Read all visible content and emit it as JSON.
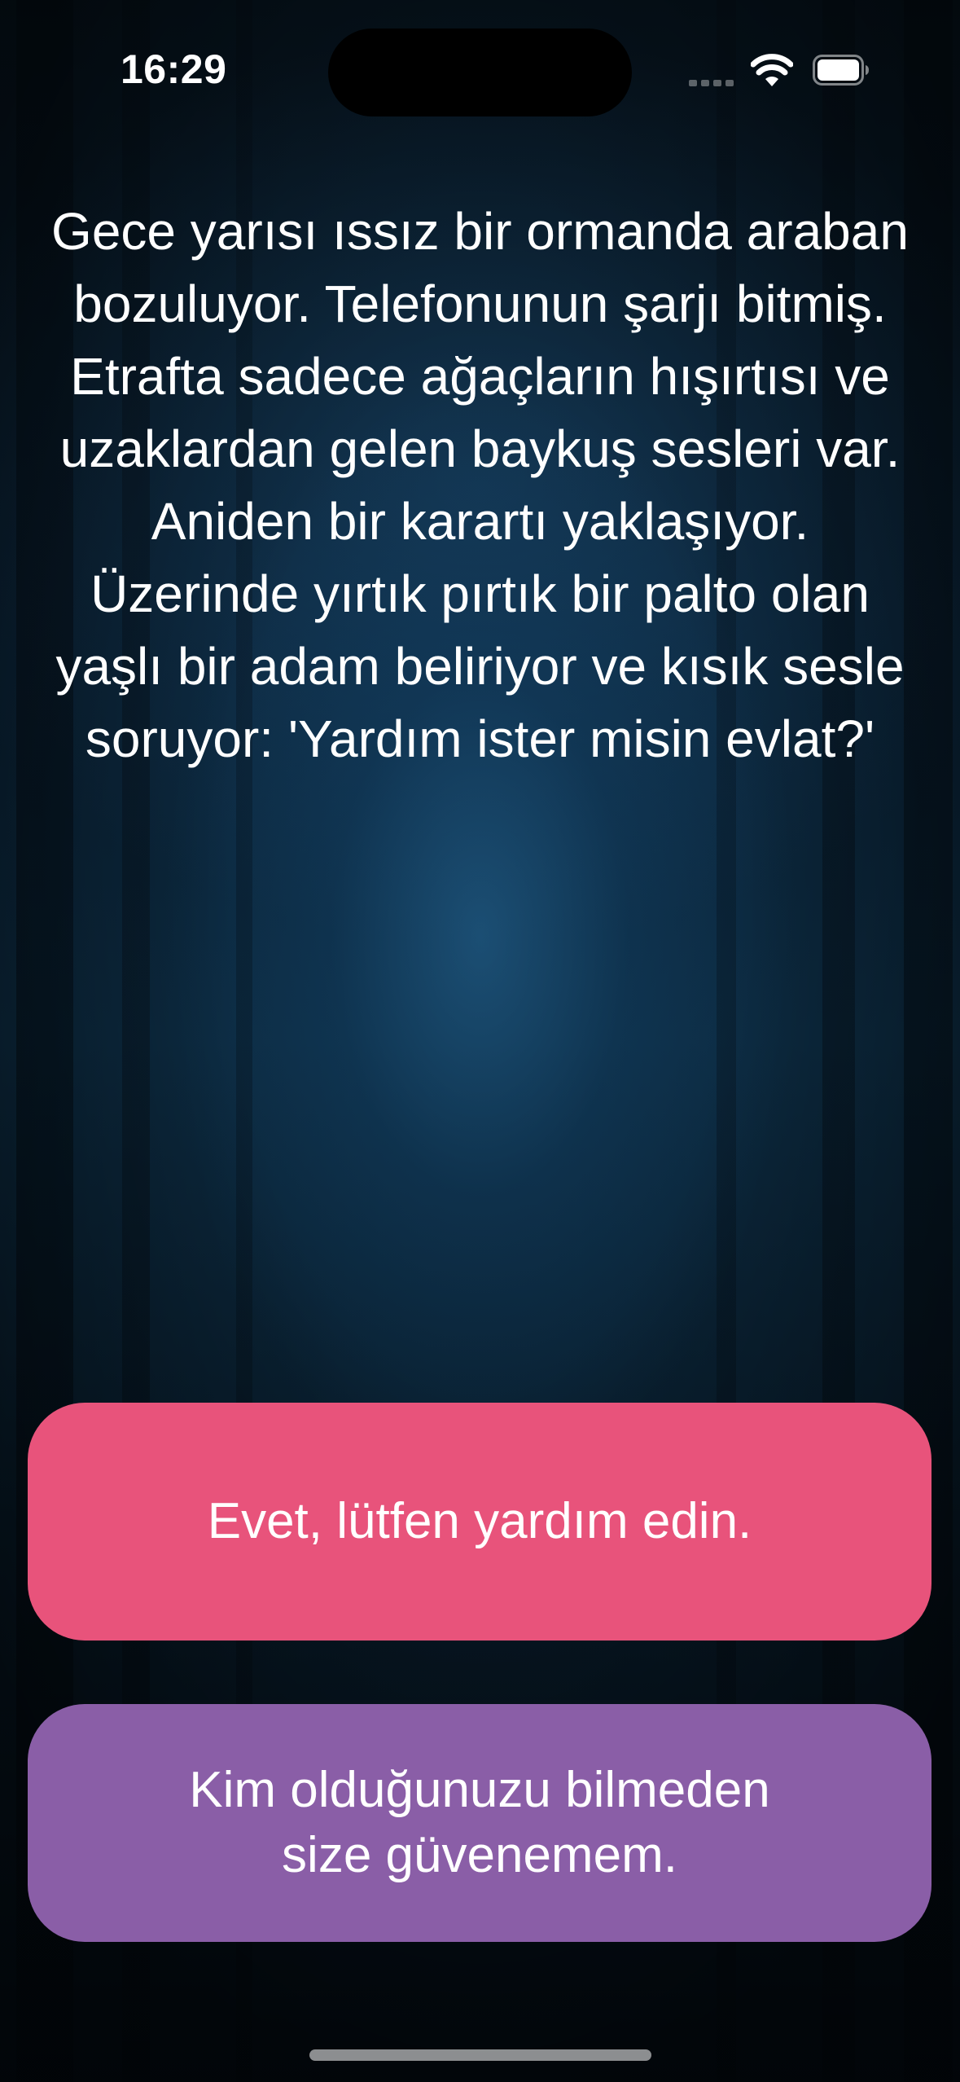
{
  "status_bar": {
    "time": "16:29",
    "icons": [
      "cellular-signal-icon",
      "wifi-icon",
      "battery-icon"
    ]
  },
  "story": {
    "text": "Gece yarısı ıssız bir ormanda araban bozuluyor. Telefonunun şarjı bitmiş. Etrafta sadece ağaçların hışırtısı ve uzaklardan gelen baykuş sesleri var. Aniden bir karartı yaklaşıyor. Üzerinde yırtık pırtık bir palto olan yaşlı bir adam beliriyor ve kısık sesle soruyor: 'Yardım ister misin evlat?'"
  },
  "choices": [
    {
      "label": "Evet, lütfen yardım edin.",
      "color": "#e8537b"
    },
    {
      "label": "Kim olduğunuzu bilmeden size güvenemem.",
      "color": "#8a5ea7"
    }
  ],
  "theme": {
    "background": "dark forest with blue mist",
    "text_color": "#ffffff"
  }
}
